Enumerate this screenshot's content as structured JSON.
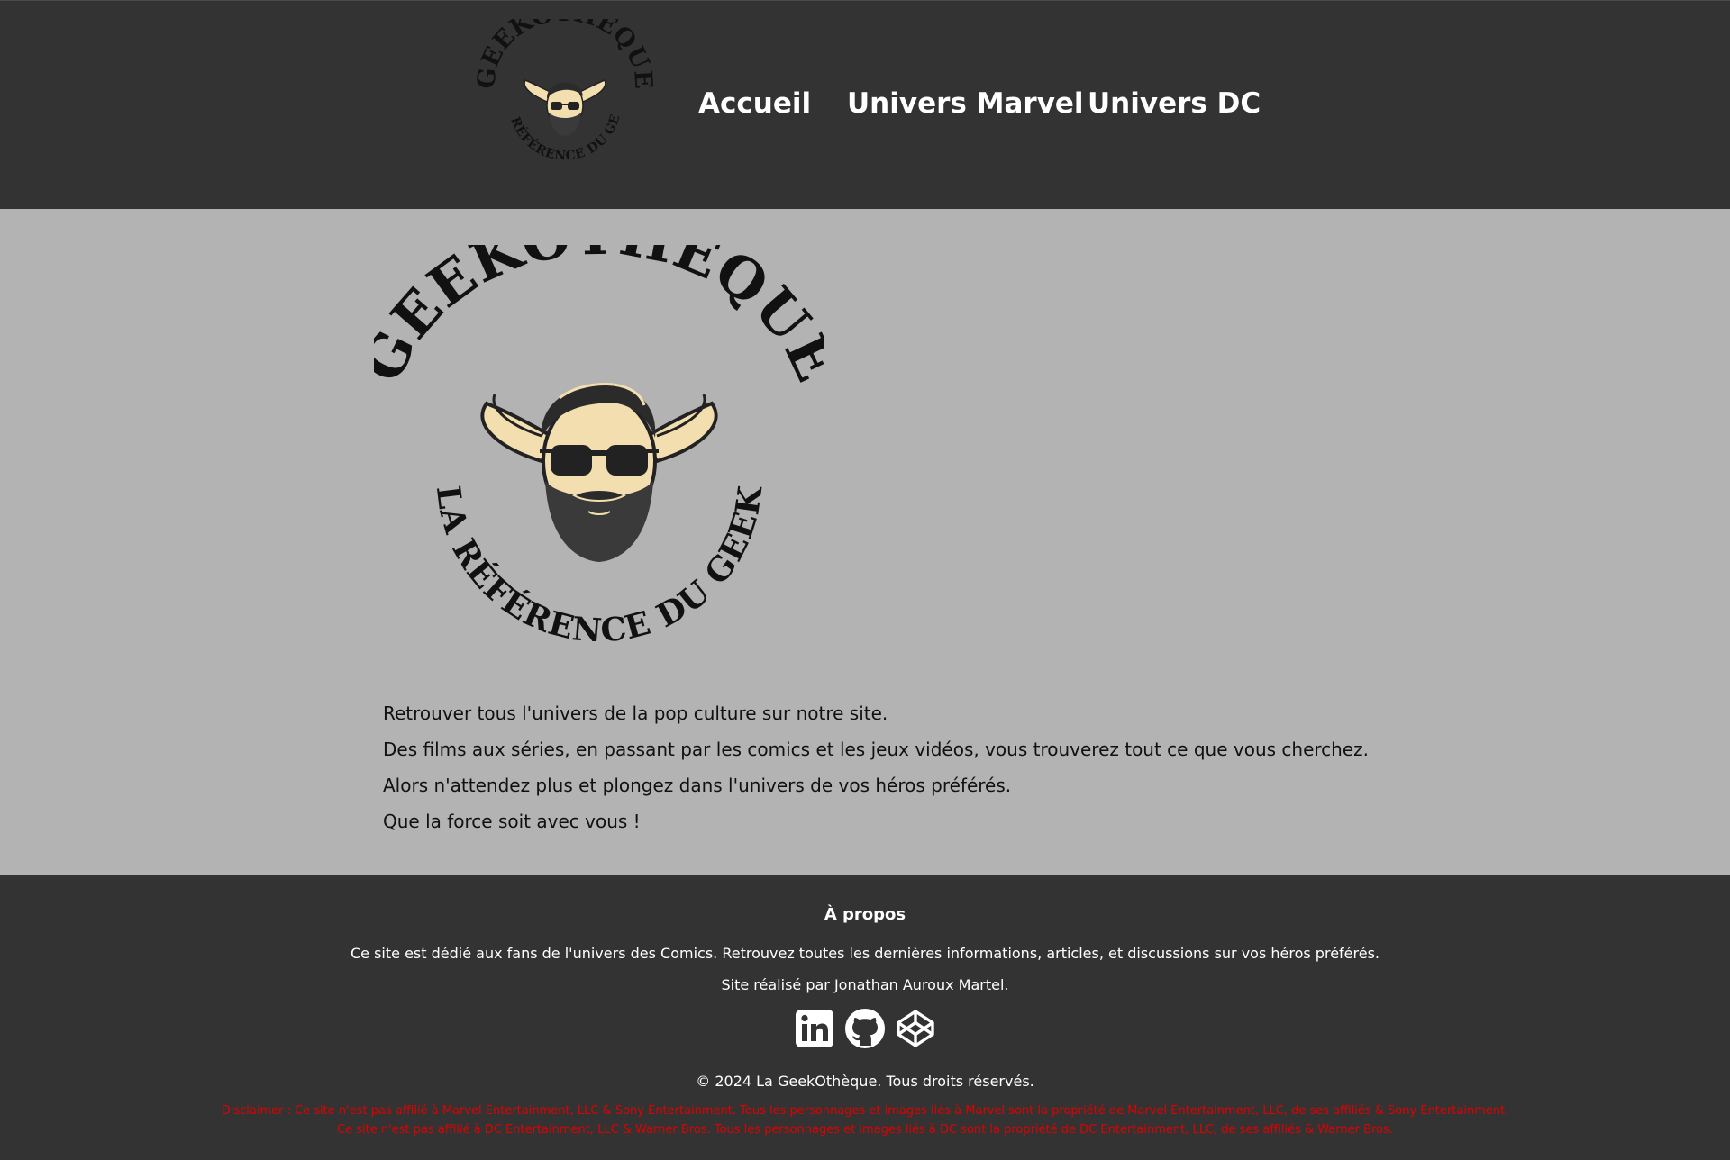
{
  "header": {
    "logo": {
      "arc_top": "GEEKOTHÈQUE",
      "arc_bottom": "LA RÉFÉRENCE DU GEEK",
      "alt": "GeekOthèque logo"
    },
    "nav": [
      {
        "label": "Accueil"
      },
      {
        "label": "Univers Marvel"
      },
      {
        "label": "Univers DC"
      }
    ]
  },
  "main": {
    "logo": {
      "arc_top": "GEEKOTHÈQUE",
      "arc_bottom": "LA RÉFÉRENCE DU GEEK"
    },
    "paragraphs": [
      "Retrouver tous l'univers de la pop culture sur notre site.",
      "Des films aux séries, en passant par les comics et les jeux vidéos, vous trouverez tout ce que vous cherchez.",
      "Alors n'attendez plus et plongez dans l'univers de vos héros préférés.",
      "Que la force soit avec vous !"
    ]
  },
  "footer": {
    "title": "À propos",
    "description": "Ce site est dédié aux fans de l'univers des Comics. Retrouvez toutes les dernières informations, articles, et discussions sur vos héros préférés.",
    "credit": "Site réalisé par Jonathan Auroux Martel.",
    "socials": [
      {
        "icon": "linkedin-icon"
      },
      {
        "icon": "github-icon"
      },
      {
        "icon": "codepen-icon"
      }
    ],
    "copyright": "© 2024 La GeekOthèque. Tous droits réservés.",
    "disclaimer": [
      "Disclaimer : Ce site n'est pas affilié à Marvel Entertainment, LLC & Sony Entertainment. Tous les personnages et images liés à Marvel sont la propriété de Marvel Entertainment, LLC, de ses affiliés & Sony Entertainment.",
      "Ce site n'est pas affilié à DC Entertainment, LLC & Warner Bros. Tous les personnages et images liés à DC sont la propriété de DC Entertainment, LLC, de ses affiliés & Warner Bros."
    ]
  },
  "colors": {
    "header_bg": "#333333",
    "main_bg": "#b3b3b3",
    "footer_bg": "#333333",
    "disclaimer": "#e00000",
    "logo_cream": "#f3deb0",
    "logo_dark": "#222222"
  }
}
